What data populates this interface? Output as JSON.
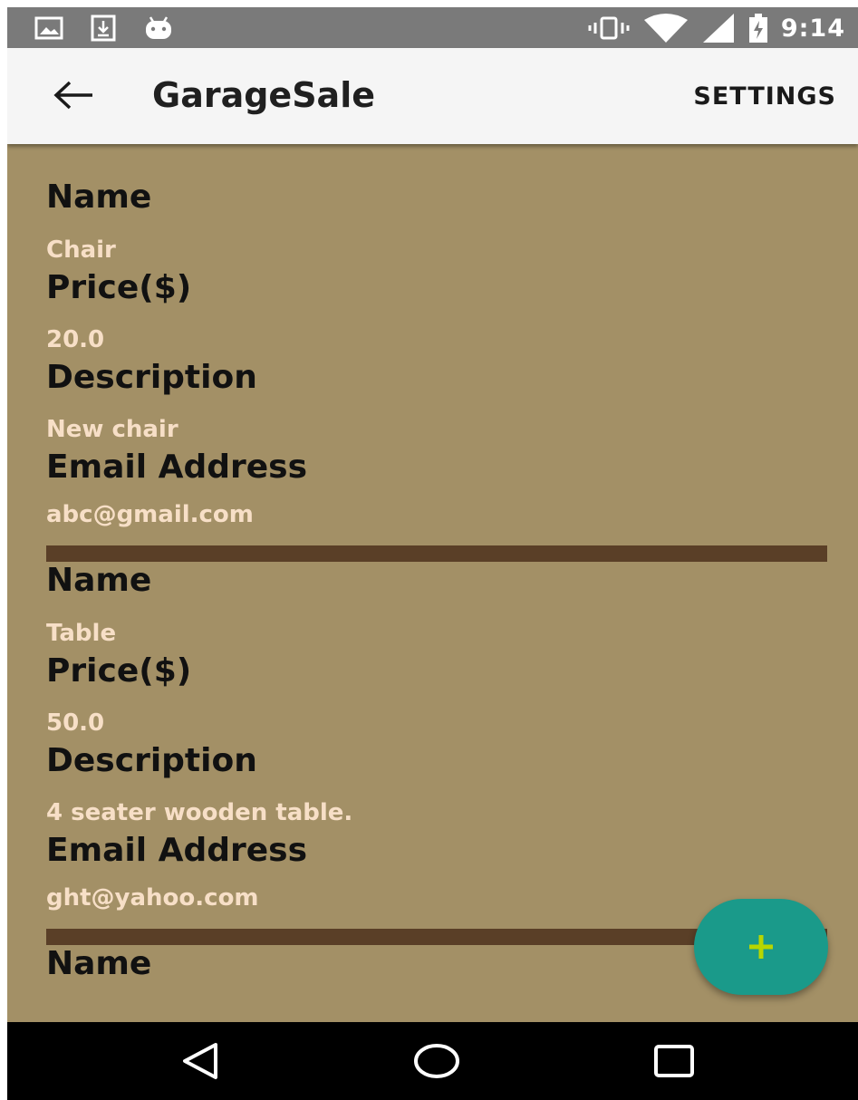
{
  "status_bar": {
    "time": "9:14",
    "left_icons": [
      "image-icon",
      "download-icon",
      "android-icon"
    ],
    "right_icons": [
      "vibrate-icon",
      "wifi-icon",
      "signal-icon",
      "battery-charging-icon"
    ]
  },
  "app_bar": {
    "title": "GarageSale",
    "settings_label": "SETTINGS"
  },
  "labels": {
    "name": "Name",
    "price": "Price($)",
    "description": "Description",
    "email": "Email Address"
  },
  "items": [
    {
      "name": "Chair",
      "price": "20.0",
      "description": "New chair",
      "email": "abc@gmail.com"
    },
    {
      "name": "Table",
      "price": "50.0",
      "description": "4 seater wooden table.",
      "email": "ght@yahoo.com"
    }
  ],
  "colors": {
    "background": "#a39066",
    "divider": "#5a3f27",
    "value_text": "#f7dfc7",
    "fab": "#1a9a8a",
    "fab_icon": "#b8d600"
  }
}
